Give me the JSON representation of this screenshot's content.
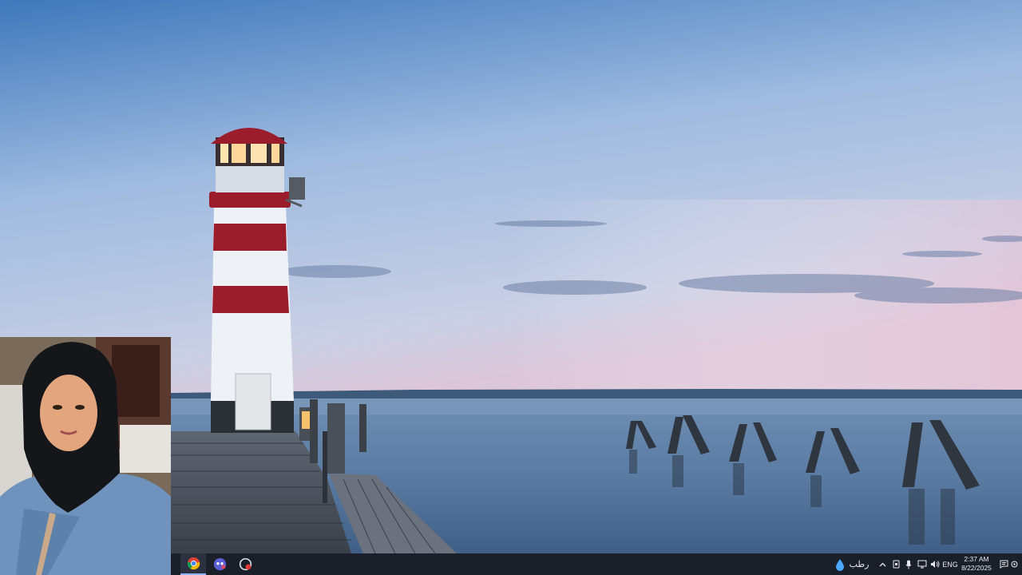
{
  "colors": {
    "sky_top": "#4a7fbf",
    "sky_mid": "#a9c2e3",
    "sky_horizon": "#d8c9dd",
    "water": "#4f7197",
    "lighthouse_red": "#9b1d2c",
    "taskbar": "#1b1f2a"
  },
  "taskbar": {
    "apps": [
      {
        "icon": "chrome-icon"
      },
      {
        "icon": "assistant-app-icon"
      },
      {
        "icon": "screen-recorder-icon"
      }
    ],
    "weather": {
      "icon": "raindrop-icon",
      "label": "رطب"
    },
    "tray_icons": [
      "chevron-up-icon",
      "tablet-icon",
      "microphone-icon",
      "network-icon",
      "speaker-icon"
    ],
    "language": "ENG",
    "time": "2:37 AM",
    "date": "8/22/2025",
    "notification_icon": "notification-icon"
  }
}
